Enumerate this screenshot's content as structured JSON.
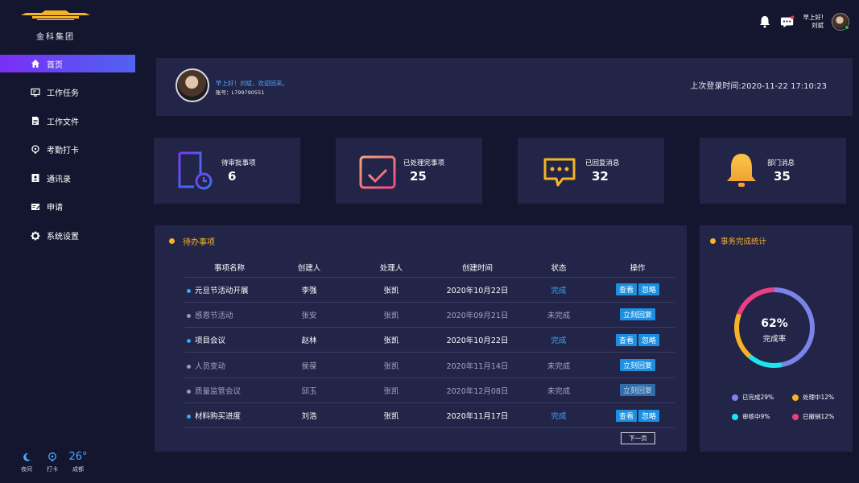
{
  "logo": {
    "text": "金科集团"
  },
  "nav": [
    {
      "label": "首页",
      "icon": "home-icon",
      "active": true
    },
    {
      "label": "工作任务",
      "icon": "monitor-icon"
    },
    {
      "label": "工作文件",
      "icon": "file-icon"
    },
    {
      "label": "考勤打卡",
      "icon": "location-pin-icon"
    },
    {
      "label": "通讯录",
      "icon": "contact-book-icon"
    },
    {
      "label": "申请",
      "icon": "edit-form-icon"
    },
    {
      "label": "系统设置",
      "icon": "gear-icon"
    }
  ],
  "weather": {
    "night_label": "夜间",
    "checkin_label": "打卡",
    "temp": "26°",
    "city": "成都"
  },
  "header": {
    "greeting": "早上好!",
    "user": "刘斌"
  },
  "welcome": {
    "greeting": "早上好！刘斌，欢迎回来。",
    "account": "账号：L799790551",
    "last_login": "上次登录时间:2020-11-22  17:10:23"
  },
  "stats": [
    {
      "label": "待审批事项",
      "value": "6",
      "icon": "document-clock-icon"
    },
    {
      "label": "已处理完事项",
      "value": "25",
      "icon": "calendar-check-icon"
    },
    {
      "label": "已回复消息",
      "value": "32",
      "icon": "chat-bubble-icon"
    },
    {
      "label": "部门消息",
      "value": "35",
      "icon": "bell-icon"
    }
  ],
  "todo": {
    "title": "待办事项",
    "columns": [
      "事项名称",
      "创建人",
      "处理人",
      "创建时间",
      "状态",
      "操作"
    ],
    "rows": [
      {
        "name": "元旦节活动开展",
        "creator": "李强",
        "handler": "张凯",
        "date": "2020年10月22日",
        "status": "完成",
        "actions": [
          "查看",
          "忽略"
        ],
        "dim": false,
        "bullet": "#3ba6ff"
      },
      {
        "name": "感恩节活动",
        "creator": "张安",
        "handler": "张凯",
        "date": "2020年09月21日",
        "status": "未完成",
        "actions": [
          "立刻回复"
        ],
        "dim": true,
        "bullet": "#9a9cb4"
      },
      {
        "name": "项目会议",
        "creator": "赵林",
        "handler": "张凯",
        "date": "2020年10月22日",
        "status": "完成",
        "actions": [
          "查看",
          "忽略"
        ],
        "dim": false,
        "bullet": "#3ba6ff"
      },
      {
        "name": "人员变动",
        "creator": "侯葆",
        "handler": "张凯",
        "date": "2020年11月14日",
        "status": "未完成",
        "actions": [
          "立刻回复"
        ],
        "dim": true,
        "bullet": "#9a9cb4"
      },
      {
        "name": "质量监管会议",
        "creator": "邱玉",
        "handler": "张凯",
        "date": "2020年12月08日",
        "status": "未完成",
        "actions": [
          "立刻回复"
        ],
        "dim": true,
        "faded": true,
        "bullet": "#9a9cb4"
      },
      {
        "name": "材料购买进度",
        "creator": "刘浩",
        "handler": "张凯",
        "date": "2020年11月17日",
        "status": "完成",
        "actions": [
          "查看",
          "忽略"
        ],
        "dim": false,
        "bullet": "#3ba6ff"
      }
    ],
    "next_page": "下一页"
  },
  "completion": {
    "title": "事务完成统计",
    "percent": "62%",
    "label": "完成率",
    "legend": [
      {
        "label": "已完成29%",
        "color": "#7c83e8",
        "value": 29
      },
      {
        "label": "处理中12%",
        "color": "#f7b325",
        "value": 12
      },
      {
        "label": "审核中9%",
        "color": "#1de4ef",
        "value": 9
      },
      {
        "label": "已撤销12%",
        "color": "#ec3f82",
        "value": 12
      }
    ]
  },
  "colors": {
    "bg": "#141630",
    "card": "#222448",
    "accent": "#7a2ff5",
    "link": "#3ba6ff",
    "warn": "#f7b325"
  }
}
